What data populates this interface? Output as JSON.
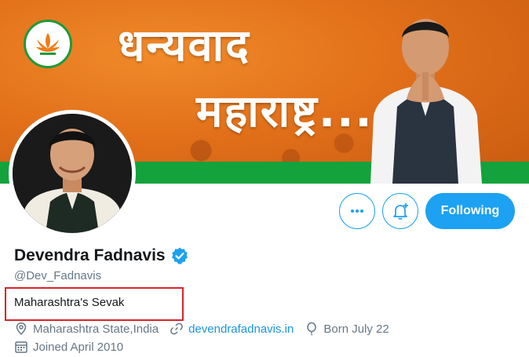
{
  "banner": {
    "headline_line1": "धन्यवाद",
    "headline_line2": "महाराष्ट्र...",
    "colors": {
      "saffron": "#e2701a",
      "green": "#14a23c"
    },
    "logo_icon": "bjp-lotus-icon"
  },
  "profile": {
    "display_name": "Devendra Fadnavis",
    "handle": "@Dev_Fadnavis",
    "verified_icon": "verified-badge-icon",
    "bio": "Maharashtra's Sevak",
    "location": "Maharashtra State,India",
    "website": "devendrafadnavis.in",
    "birthday": "Born July 22",
    "joined": "Joined April 2010"
  },
  "actions": {
    "more_icon": "more-dots-icon",
    "notify_icon": "bell-plus-icon",
    "following_label": "Following"
  },
  "colors": {
    "accent": "#1da1f2",
    "highlight_box": "#d9232a",
    "muted": "#657786"
  }
}
